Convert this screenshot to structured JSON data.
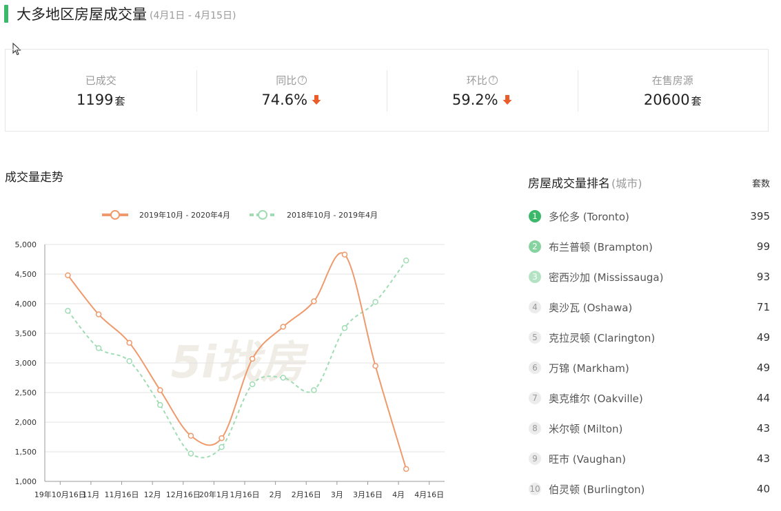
{
  "header": {
    "title": "大多地区房屋成交量",
    "date_range": "(4月1日 - 4月15日)"
  },
  "stats": [
    {
      "label": "已成交",
      "value": "1199",
      "unit": "套",
      "help": false,
      "arrow": false
    },
    {
      "label": "同比",
      "value": "74.6%",
      "unit": "",
      "help": true,
      "arrow": true
    },
    {
      "label": "环比",
      "value": "59.2%",
      "unit": "",
      "help": true,
      "arrow": true
    },
    {
      "label": "在售房源",
      "value": "20600",
      "unit": "套",
      "help": false,
      "arrow": false
    }
  ],
  "colors": {
    "accent": "#3cb86a",
    "series_current": "#ee9a6c",
    "series_previous": "#9fdcb3",
    "arrow": "#ea5d2a"
  },
  "trend": {
    "title": "成交量走势"
  },
  "chart_data": {
    "type": "line",
    "x_ticks": [
      "19年10月16日",
      "11月",
      "11月16日",
      "12月",
      "12月16日",
      "20年1月",
      "1月16日",
      "2月",
      "2月16日",
      "3月",
      "3月16日",
      "4月",
      "4月16日"
    ],
    "ylim": [
      1000,
      5000
    ],
    "y_ticks": [
      "1,000",
      "1,500",
      "2,000",
      "2,500",
      "3,000",
      "3,500",
      "4,000",
      "4,500",
      "5,000"
    ],
    "y_values": [
      1000,
      1500,
      2000,
      2500,
      3000,
      3500,
      4000,
      4500,
      5000
    ],
    "grid": true,
    "legend_position": "top",
    "series": [
      {
        "name": "2019年10月 - 2020年4月",
        "style": "solid",
        "values": [
          4480,
          3820,
          3340,
          2540,
          1770,
          1730,
          3070,
          3610,
          4040,
          4830,
          2950,
          1210
        ]
      },
      {
        "name": "2018年10月 - 2019年4月",
        "style": "dashed",
        "values": [
          3880,
          3250,
          3030,
          2290,
          1470,
          1580,
          2640,
          2750,
          2540,
          3590,
          4030,
          4730
        ]
      }
    ]
  },
  "ranking": {
    "title": "房屋成交量排名",
    "subtitle": "(城市)",
    "unit_header": "套数",
    "items": [
      {
        "rank": "1",
        "name": "多伦多 (Toronto)",
        "count": "395",
        "badge": "#3cb86a"
      },
      {
        "rank": "2",
        "name": "布兰普顿 (Brampton)",
        "count": "99",
        "badge": "#86d3a0"
      },
      {
        "rank": "3",
        "name": "密西沙加 (Mississauga)",
        "count": "93",
        "badge": "#b4e3c3"
      },
      {
        "rank": "4",
        "name": "奥沙瓦 (Oshawa)",
        "count": "71",
        "badge": "#ececec"
      },
      {
        "rank": "5",
        "name": "克拉灵顿 (Clarington)",
        "count": "49",
        "badge": "#ececec"
      },
      {
        "rank": "6",
        "name": "万锦 (Markham)",
        "count": "49",
        "badge": "#ececec"
      },
      {
        "rank": "7",
        "name": "奥克维尔 (Oakville)",
        "count": "44",
        "badge": "#ececec"
      },
      {
        "rank": "8",
        "name": "米尔顿 (Milton)",
        "count": "43",
        "badge": "#ececec"
      },
      {
        "rank": "9",
        "name": "旺市 (Vaughan)",
        "count": "43",
        "badge": "#ececec"
      },
      {
        "rank": "10",
        "name": "伯灵顿 (Burlington)",
        "count": "40",
        "badge": "#ececec"
      }
    ]
  }
}
